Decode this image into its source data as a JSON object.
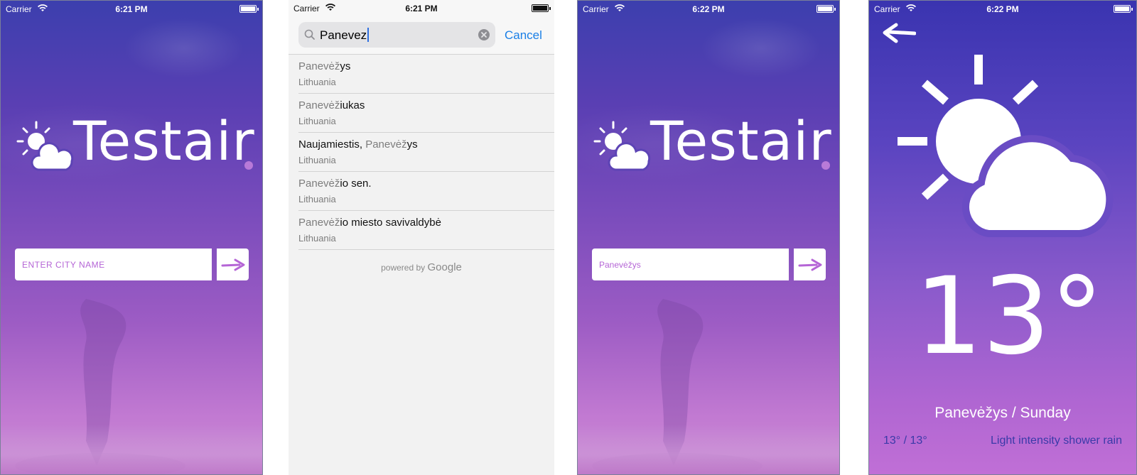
{
  "status_1": {
    "carrier": "Carrier",
    "time": "6:21 PM"
  },
  "status_2": {
    "carrier": "Carrier",
    "time": "6:21 PM"
  },
  "status_3": {
    "carrier": "Carrier",
    "time": "6:22 PM"
  },
  "status_4": {
    "carrier": "Carrier",
    "time": "6:22 PM"
  },
  "logo": {
    "text": "Testair"
  },
  "screen1": {
    "input_placeholder": "ENTER CITY NAME"
  },
  "search": {
    "query": "Panevez",
    "cancel_label": "Cancel"
  },
  "results": [
    {
      "pre": "",
      "match": "Panevėž",
      "post": "ys",
      "subtitle": "Lithuania"
    },
    {
      "pre": "",
      "match": "Panevėž",
      "post": "iukas",
      "subtitle": "Lithuania"
    },
    {
      "pre": "Naujamiestis, ",
      "match": "Panevėž",
      "post": "ys",
      "subtitle": "Lithuania"
    },
    {
      "pre": "",
      "match": "Panevėž",
      "post": "io sen.",
      "subtitle": "Lithuania"
    },
    {
      "pre": "",
      "match": "Panevėž",
      "post": "io miesto savivaldybė",
      "subtitle": "Lithuania"
    }
  ],
  "powered_by": {
    "prefix": "powered by",
    "brand": "Google"
  },
  "screen3": {
    "input_value": "Panevėžys"
  },
  "weather": {
    "temperature": "13°",
    "place_day": "Panevėžys / Sunday",
    "min_max": "13° / 13°",
    "description": "Light intensity shower rain"
  },
  "colors": {
    "gradient_top": "#3c3fae",
    "gradient_bottom": "#c98cd6",
    "accent_purple": "#b565d6",
    "link_blue": "#1a7fe6",
    "weather_info_blue": "#3a3aa8"
  },
  "icons": [
    "wifi-icon",
    "battery-icon",
    "sun-cloud-icon",
    "arrow-right-icon",
    "search-icon",
    "clear-icon",
    "back-arrow-icon",
    "weather-icon"
  ]
}
